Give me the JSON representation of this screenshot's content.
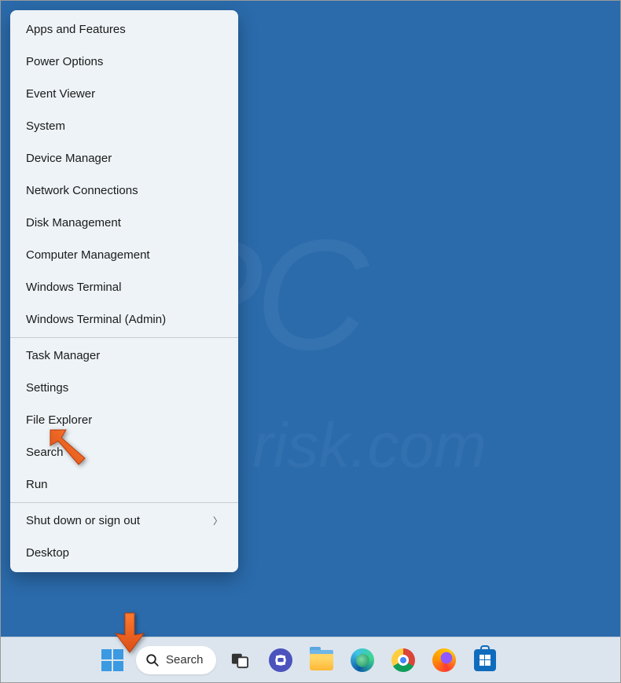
{
  "watermark": {
    "main": "PC",
    "sub": "risk.com"
  },
  "contextMenu": {
    "section1": [
      {
        "id": "apps-and-features",
        "label": "Apps and Features"
      },
      {
        "id": "power-options",
        "label": "Power Options"
      },
      {
        "id": "event-viewer",
        "label": "Event Viewer"
      },
      {
        "id": "system",
        "label": "System"
      },
      {
        "id": "device-manager",
        "label": "Device Manager"
      },
      {
        "id": "network-connections",
        "label": "Network Connections"
      },
      {
        "id": "disk-management",
        "label": "Disk Management"
      },
      {
        "id": "computer-management",
        "label": "Computer Management"
      },
      {
        "id": "windows-terminal",
        "label": "Windows Terminal"
      },
      {
        "id": "windows-terminal-admin",
        "label": "Windows Terminal (Admin)"
      }
    ],
    "section2": [
      {
        "id": "task-manager",
        "label": "Task Manager"
      },
      {
        "id": "settings",
        "label": "Settings"
      },
      {
        "id": "file-explorer",
        "label": "File Explorer"
      },
      {
        "id": "search",
        "label": "Search"
      },
      {
        "id": "run",
        "label": "Run"
      }
    ],
    "section3": [
      {
        "id": "shut-down-or-sign-out",
        "label": "Shut down or sign out",
        "submenu": true
      },
      {
        "id": "desktop",
        "label": "Desktop"
      }
    ]
  },
  "taskbar": {
    "searchLabel": "Search"
  }
}
